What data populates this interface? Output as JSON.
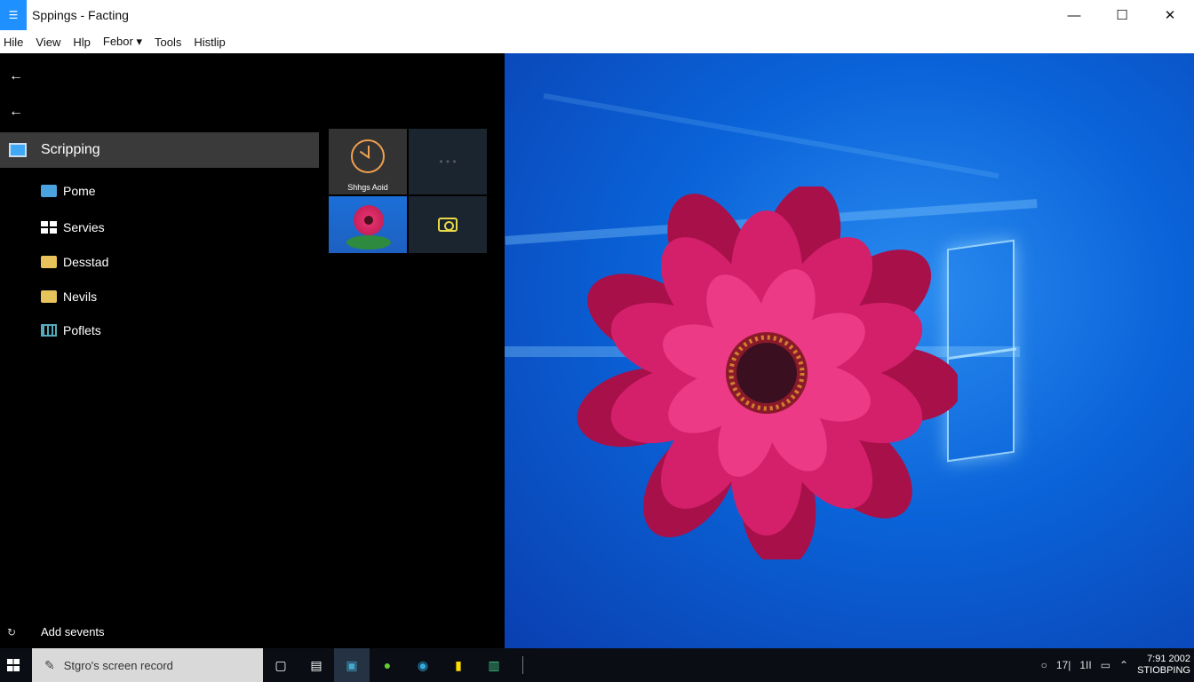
{
  "window": {
    "title": "Sppings  -  Facting",
    "controls": {
      "minimize": "—",
      "maximize": "☐",
      "close": "✕"
    }
  },
  "menu": [
    "Hile",
    "View",
    "Hlp",
    "Febor ▾",
    "Tools",
    "Histlip"
  ],
  "sidebar": {
    "back_icon": "←",
    "selected": {
      "label": "Scripping",
      "icon": "monitor-icon"
    },
    "items": [
      {
        "label": "Pome",
        "icon": "folder-blue-icon"
      },
      {
        "label": "Servies",
        "icon": "windows-icon"
      },
      {
        "label": "Desstad",
        "icon": "folder-icon"
      },
      {
        "label": "Nevils",
        "icon": "folder-icon"
      },
      {
        "label": "Poflets",
        "icon": "grid-icon"
      }
    ],
    "footer": {
      "label": "Add sevents",
      "icon": "↻"
    }
  },
  "tiles": [
    {
      "label": "Shhgs Aoid",
      "icon": "clock-icon"
    },
    {
      "label": "• • •",
      "icon": "more-icon"
    },
    {
      "label": "",
      "icon": "flower-thumbnail"
    },
    {
      "label": "",
      "icon": "camera-icon"
    }
  ],
  "taskbar": {
    "search_placeholder": "Stgro's screen record",
    "search_icon": "✎",
    "icons": [
      "▢",
      "▤",
      "▣",
      "●",
      "◉",
      "▮",
      "▥"
    ],
    "tray": [
      "○",
      "17|",
      "1II",
      "▭",
      "⌃"
    ],
    "clock_time": "7:91 2002",
    "clock_sub": "STIOBPING"
  },
  "colors": {
    "accent": "#1e90ff",
    "sidebar_selected": "#3a3a3a",
    "desktop_blue": "#0a63d8",
    "flower_pink": "#d4206a"
  }
}
